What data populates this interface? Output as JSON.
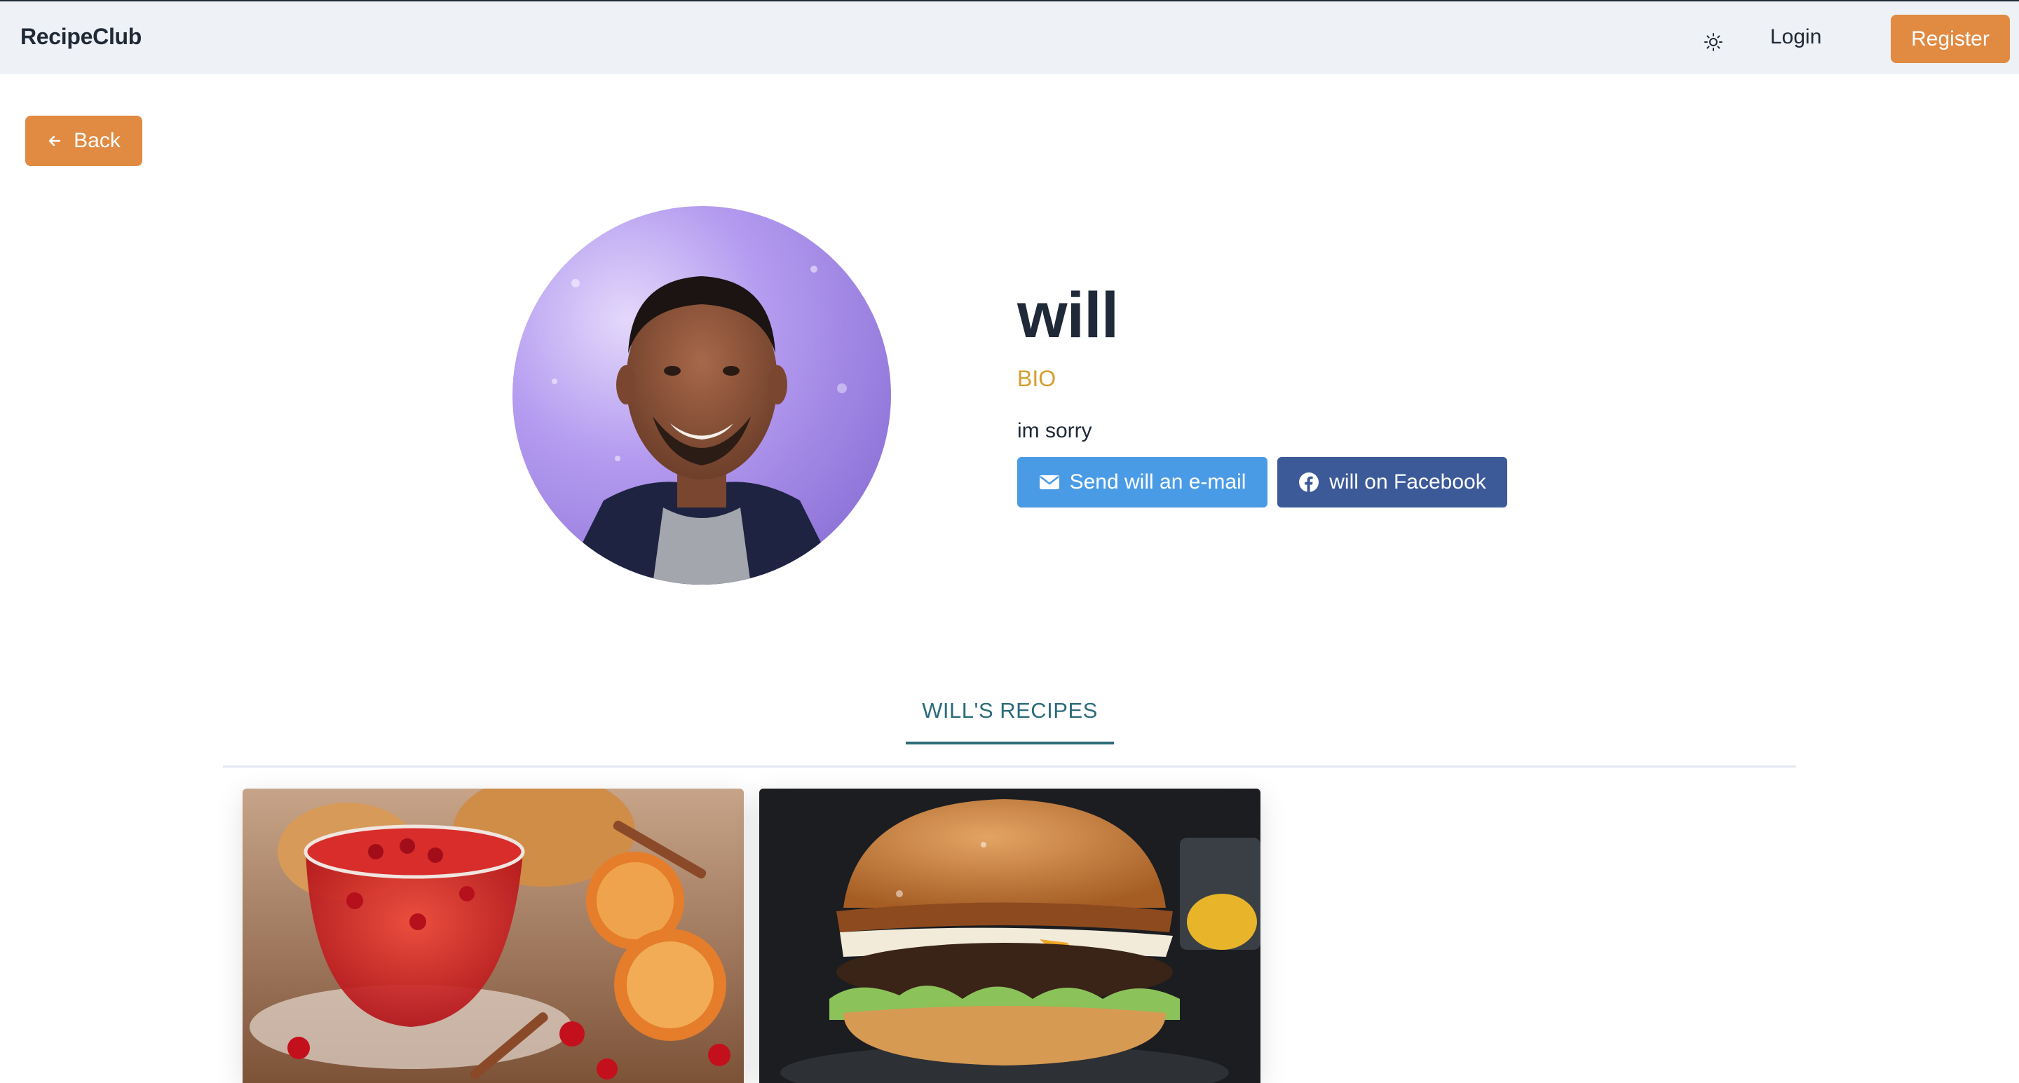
{
  "navbar": {
    "brand": "RecipeClub",
    "theme_icon": "sun-icon",
    "login_label": "Login",
    "register_label": "Register"
  },
  "back_button": {
    "label": "Back",
    "icon": "arrow-left-icon"
  },
  "profile": {
    "name": "will",
    "bio_label": "BIO",
    "bio_text": "im sorry",
    "email_button_label": "Send will an e-mail",
    "email_icon": "envelope-icon",
    "facebook_button_label": "will on Facebook",
    "facebook_icon": "facebook-icon"
  },
  "tabs": [
    {
      "label": "WILL'S RECIPES",
      "active": true
    }
  ],
  "recipes": [
    {
      "image": "red tea with cranberries, orange slices and cinnamon"
    },
    {
      "image": "cheeseburger with crispy onions and lettuce"
    }
  ],
  "colors": {
    "accent_orange": "#e08a42",
    "email_blue": "#4a9be6",
    "facebook_blue": "#3d5a98",
    "bio_gold": "#d69e2e",
    "tab_teal": "#2c6b7a",
    "navbar_bg": "#eef1f5"
  }
}
